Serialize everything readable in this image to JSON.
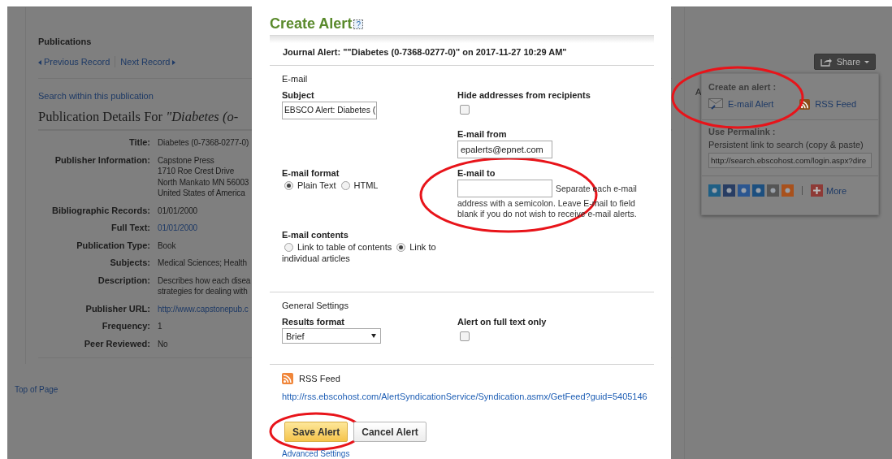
{
  "page": {
    "section_title": "Publications",
    "prev_link": "Previous Record",
    "next_link": "Next Record",
    "search_link": "Search within this publication",
    "heading": "Publication Details For *\"Diabetes (o-*",
    "details": [
      {
        "label": "Title:",
        "kind": "text",
        "lines": [
          "Diabetes (0-7368-0277-0)"
        ]
      },
      {
        "label": "Publisher Information:",
        "kind": "text",
        "lines": [
          "Capstone Press",
          "1710 Roe Crest Drive",
          "North Mankato MN 56003",
          "United States of America"
        ]
      },
      {
        "label": "Bibliographic Records:",
        "kind": "text",
        "lines": [
          "01/01/2000"
        ]
      },
      {
        "label": "Full Text:",
        "kind": "link",
        "lines": [
          "01/01/2000"
        ]
      },
      {
        "label": "Publication Type:",
        "kind": "text",
        "lines": [
          "Book"
        ]
      },
      {
        "label": "Subjects:",
        "kind": "text",
        "lines": [
          "Medical Sciences; Health"
        ]
      },
      {
        "label": "Description:",
        "kind": "text",
        "lines": [
          "Describes how each disea",
          "strategies for dealing with"
        ]
      },
      {
        "label": "Publisher URL:",
        "kind": "link",
        "lines": [
          "http://www.capstonepub.c"
        ]
      },
      {
        "label": "Frequency:",
        "kind": "text",
        "lines": [
          "1"
        ]
      },
      {
        "label": "Peer Reviewed:",
        "kind": "text",
        "lines": [
          "No"
        ]
      }
    ],
    "top_link": "Top of Page",
    "side_letter": "A"
  },
  "share": {
    "button": "Share",
    "alert_heading": "Create an alert :",
    "email_alert": "E-mail Alert",
    "rss_feed": "RSS Feed",
    "permalink_heading": "Use Permalink :",
    "permalink_hint": "Persistent link to search (copy & paste)",
    "permalink_value": "http://search.ebscohost.com/login.aspx?dire",
    "icons": [
      {
        "color": "#1f5f85"
      },
      {
        "color": "#283d63"
      },
      {
        "color": "#2b5690"
      },
      {
        "color": "#1c4f7f"
      },
      {
        "color": "#555555"
      },
      {
        "color": "#a8511c"
      }
    ],
    "more": "More"
  },
  "dialog": {
    "title": "Create Alert",
    "help": "?",
    "summary": "Journal Alert: \"\"Diabetes (0-7368-0277-0)\" on 2017-11-27 10:29 AM\"",
    "email_section": "E-mail",
    "subject": {
      "label": "Subject",
      "value": "EBSCO Alert: Diabetes ("
    },
    "hide_addresses": {
      "label": "Hide addresses from recipients",
      "checked": false
    },
    "email_from": {
      "label": "E-mail from",
      "value": "epalerts@epnet.com"
    },
    "email_format": {
      "label": "E-mail format",
      "options": [
        {
          "lines": [
            "Plain Text"
          ],
          "selected": true
        },
        {
          "lines": [
            "HTML"
          ],
          "selected": false
        }
      ]
    },
    "email_to": {
      "label": "E-mail to",
      "hint": [
        "Separate each e-mail",
        "address with a semicolon. Leave E-mail to field blank if you do not wish to receive e-mail alerts."
      ]
    },
    "email_contents": {
      "label": "E-mail contents",
      "options": [
        {
          "lines": [
            "Link to table of contents"
          ],
          "selected": false
        },
        {
          "lines": [
            "Link to",
            "individual articles"
          ],
          "selected": true
        }
      ]
    },
    "general_section": "General Settings",
    "results_format": {
      "label": "Results format",
      "value": "Brief"
    },
    "full_text_only": {
      "label": "Alert on full text only",
      "checked": false
    },
    "rss": {
      "label": "RSS Feed",
      "url": "http://rss.ebscohost.com/AlertSyndicationService/Syndication.asmx/GetFeed?guid=5405146"
    },
    "buttons": [
      {
        "label": "Save Alert",
        "kind": "primary"
      },
      {
        "label": "Cancel Alert",
        "kind": "secondary"
      }
    ],
    "advanced_link": "Advanced Settings"
  }
}
